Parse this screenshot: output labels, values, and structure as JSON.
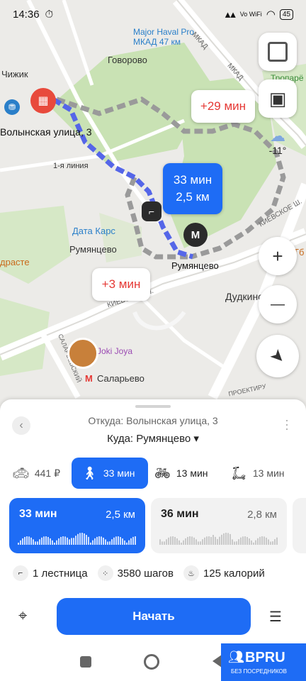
{
  "status": {
    "time": "14:36",
    "battery": "45",
    "network": "Vo WiFi"
  },
  "map": {
    "labels": {
      "poi_major": "Major Haval Pro МКАД 47 км",
      "govorovo": "Говорово",
      "chizhik": "Чижик",
      "volynskaya": "Волынская улица, 3",
      "linia": "1-я линия",
      "tropare": "Тропарё Обнинск",
      "data_kars": "Дата Карс",
      "rumyantsevo_w": "Румянцево",
      "rumyantsevo_m": "Румянцево",
      "zdrasste": "дрaсте",
      "dudkino": "Дудкино",
      "joki": "Joki Joya",
      "salarevo": "Саларьево",
      "mkad1": "МКАД",
      "mkad2": "МКАД",
      "kievskoe1": "КИЕВСКОЕ Ш.",
      "kievskoe2": "КИЕВСКОЕ Ш.",
      "salaryevsky": "САЛАРЬЕВСКИЙ",
      "proektiru": "ПРОЕКТИРУ",
      "metro_letter": "М",
      "tb": "Тб"
    },
    "route_main": {
      "time": "33 мин",
      "dist": "2,5 км"
    },
    "route_alt1": "+29 мин",
    "route_alt2": "+3 мин",
    "weather": "-11°",
    "zoom_in": "+",
    "zoom_out": "—"
  },
  "panel": {
    "from": "Откуда: Волынская улица, 3",
    "to": "Куда: Румянцево ▾",
    "modes": [
      {
        "label": "441 ₽",
        "icon": "taxi-icon"
      },
      {
        "label": "33 мин",
        "icon": "walk-icon",
        "active": true
      },
      {
        "label": "13 мин",
        "icon": "bike-icon"
      },
      {
        "label": "13 мин",
        "icon": "scooter-icon"
      }
    ],
    "routes": [
      {
        "time": "33 мин",
        "dist": "2,5 км"
      },
      {
        "time": "36 мин",
        "dist": "2,8 км"
      }
    ],
    "stats": {
      "stairs": "1 лестница",
      "steps": "3580 шагов",
      "calories": "125 калорий"
    },
    "start": "Начать"
  },
  "promo": {
    "brand": "BPRU",
    "tagline": "БЕЗ ПОСРЕДНИКОВ"
  },
  "colors": {
    "accent": "#1e6cf5",
    "alt_time": "#e53935",
    "poi_red": "#e84a3c"
  }
}
